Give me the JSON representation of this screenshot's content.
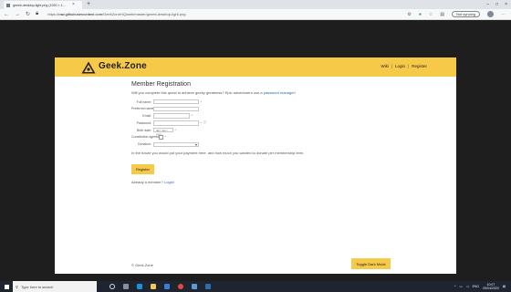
{
  "browser": {
    "tab_title": "geeek-desktop-light.png (1920 × 1...",
    "tab_close": "×",
    "new_tab": "+",
    "url_prefix": "https://",
    "url_host": "raw.githubusercontent.com",
    "url_path": "/GeekZoneHQ/web/master/geeek-desktop-light.png",
    "not_syncing": "Not syncing",
    "window_controls": [
      "–",
      "□",
      "×"
    ]
  },
  "site": {
    "brand": "Geek.Zone",
    "nav": {
      "wiki": "Wiki",
      "login": "Login",
      "register": "Register",
      "separator": "|"
    },
    "accent_color": "#f7c948"
  },
  "form": {
    "title": "Member Registration",
    "intro_text": "Will you complete this quest to achieve geeky greatness? Epic adventurers use a",
    "intro_link": "password manager!",
    "fields": {
      "full_name": {
        "label": "Full name:",
        "required": "*"
      },
      "preferred_name": {
        "label": "Preferred name:"
      },
      "email": {
        "label": "Email:",
        "required": "*"
      },
      "password": {
        "label": "Password:",
        "required": "*",
        "hint": "ⓘ"
      },
      "birth_date": {
        "label": "Birth date:",
        "placeholder": "dd / mm / yyyy",
        "required": "*"
      },
      "constitution": {
        "label": "Constitution agreed:",
        "required": "*"
      },
      "donation": {
        "label": "Donation:"
      }
    },
    "future_text": "In the future you would put your payment here, and how much you wanted to donate per membership term.",
    "register_button": "Register",
    "already_text": "Already a member?",
    "already_link": "Login!"
  },
  "footer": {
    "copyright": "© Geek.Zone",
    "dark_mode_button": "Toggle Dark Mode"
  },
  "taskbar": {
    "search_placeholder": "Type here to search",
    "language": "ENG",
    "time": "10:07",
    "date": "05/04/2020"
  }
}
